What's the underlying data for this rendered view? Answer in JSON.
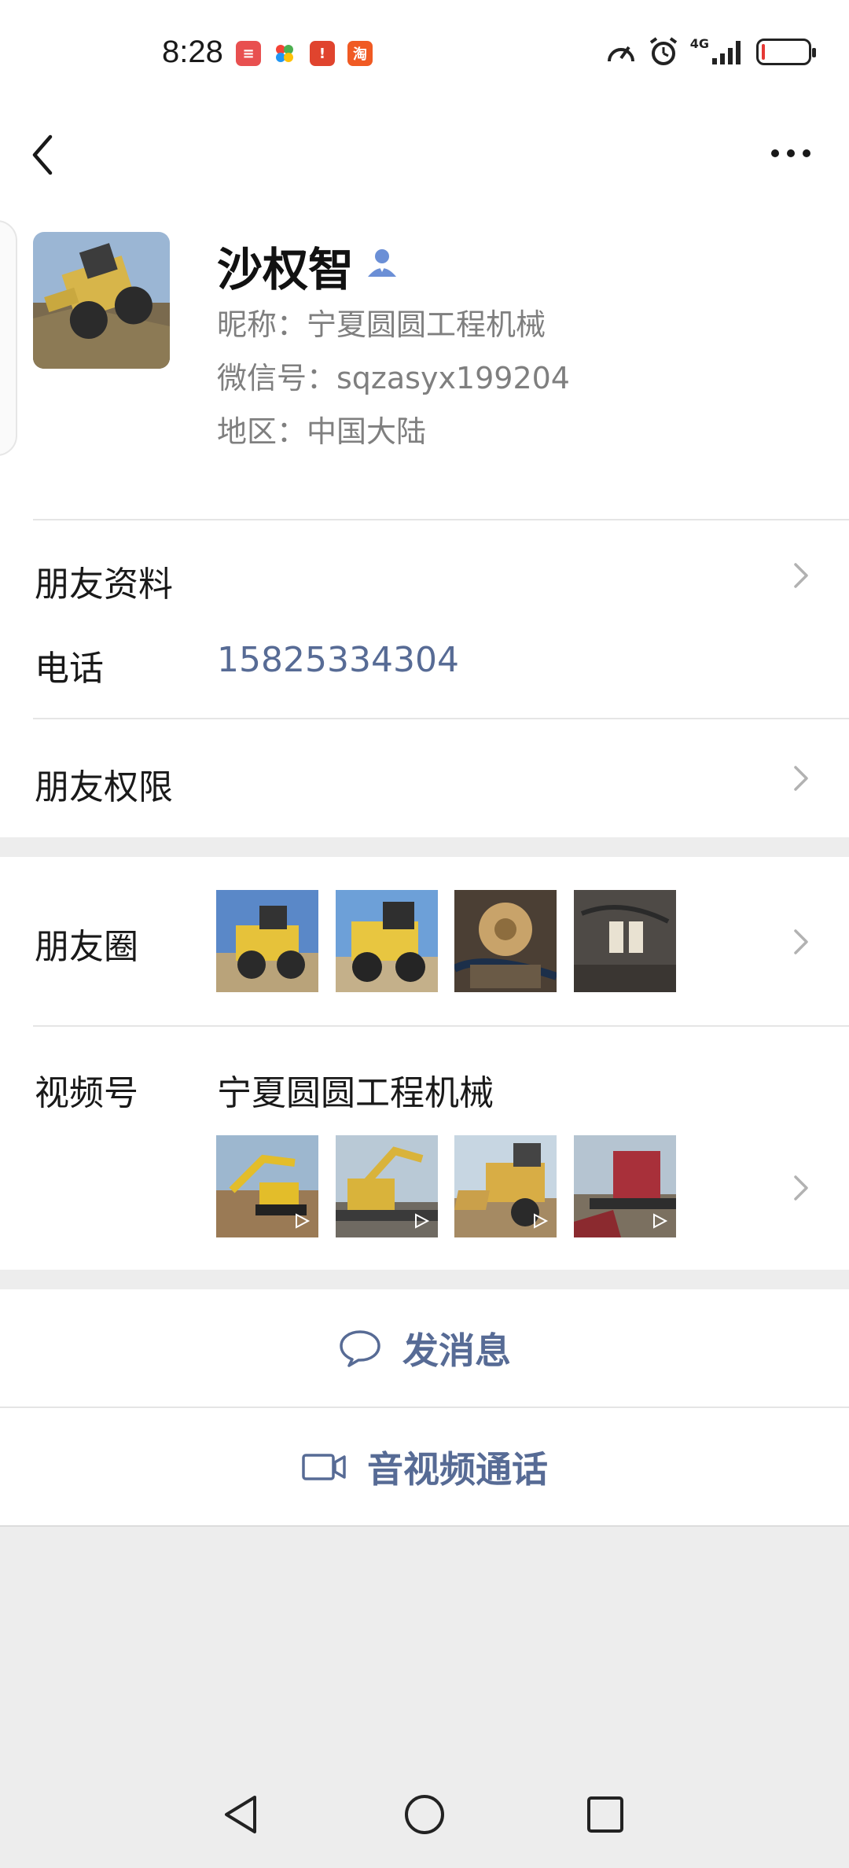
{
  "status_bar": {
    "time": "8:28",
    "apps": [
      {
        "icon": "huawei-app-icon",
        "color": "#e85050",
        "glyph": "≡"
      },
      {
        "icon": "photos-app-icon",
        "color": "#ffffff",
        "glyph": "✿"
      },
      {
        "icon": "notice-app-icon",
        "color": "#e0442e",
        "glyph": "!"
      },
      {
        "icon": "taobao-app-icon",
        "color": "#f05a23",
        "glyph": "淘"
      }
    ],
    "network": "4G",
    "battery_level": 0.08
  },
  "profile": {
    "name": "沙权智",
    "nickname": "昵称：宁夏圆圆工程机械",
    "wechat_id": "微信号：sqzasyx199204",
    "region": "地区：中国大陆"
  },
  "rows": {
    "friend_info_label": "朋友资料",
    "phone_label": "电话",
    "phone_value": "15825334304",
    "friend_permissions_label": "朋友权限",
    "moments_label": "朋友圈",
    "channels_label": "视频号",
    "channels_name": "宁夏圆圆工程机械"
  },
  "actions": {
    "send_message": "发消息",
    "video_call": "音视频通话"
  },
  "colors": {
    "link": "#576b95",
    "divider": "#e5e5e5",
    "background": "#ededed"
  }
}
